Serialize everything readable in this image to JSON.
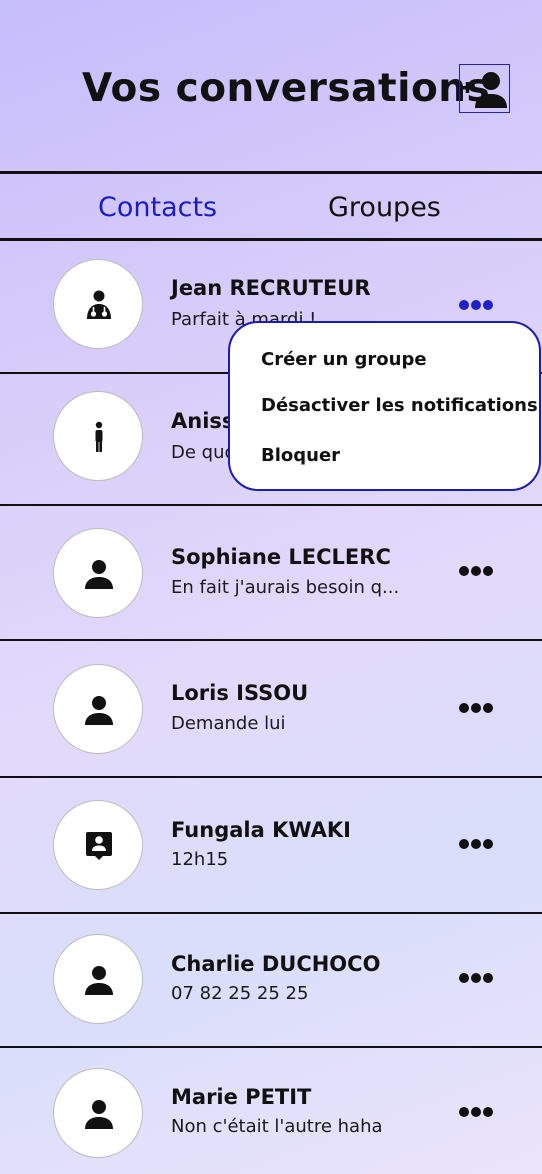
{
  "header": {
    "title": "Vos conversations",
    "add_icon": "add-contact-icon"
  },
  "tabs": [
    {
      "label": "Contacts",
      "active": true
    },
    {
      "label": "Groupes",
      "active": false
    }
  ],
  "contacts": [
    {
      "name": "Jean RECRUTEUR",
      "message": "Parfait à mardi !",
      "icon": "doctor-icon"
    },
    {
      "name": "Aniss",
      "message": "De quoi",
      "icon": "standing-person-icon"
    },
    {
      "name": "Sophiane LECLERC",
      "message": "En fait j'aurais besoin q...",
      "icon": "person-icon"
    },
    {
      "name": "Loris ISSOU",
      "message": "Demande lui",
      "icon": "person-icon"
    },
    {
      "name": "Fungala KWAKI",
      "message": "12h15",
      "icon": "person-pin-icon"
    },
    {
      "name": "Charlie DUCHOCO",
      "message": "07 82 25 25 25",
      "icon": "person-icon"
    },
    {
      "name": "Marie PETIT",
      "message": "Non c'était l'autre haha",
      "icon": "person-icon"
    }
  ],
  "context_menu": {
    "items": [
      "Créer un groupe",
      "Désactiver les notifications",
      "Bloquer"
    ]
  },
  "colors": {
    "accent": "#1c1cc4",
    "menu_border": "#1c1cb0",
    "text": "#111111"
  }
}
